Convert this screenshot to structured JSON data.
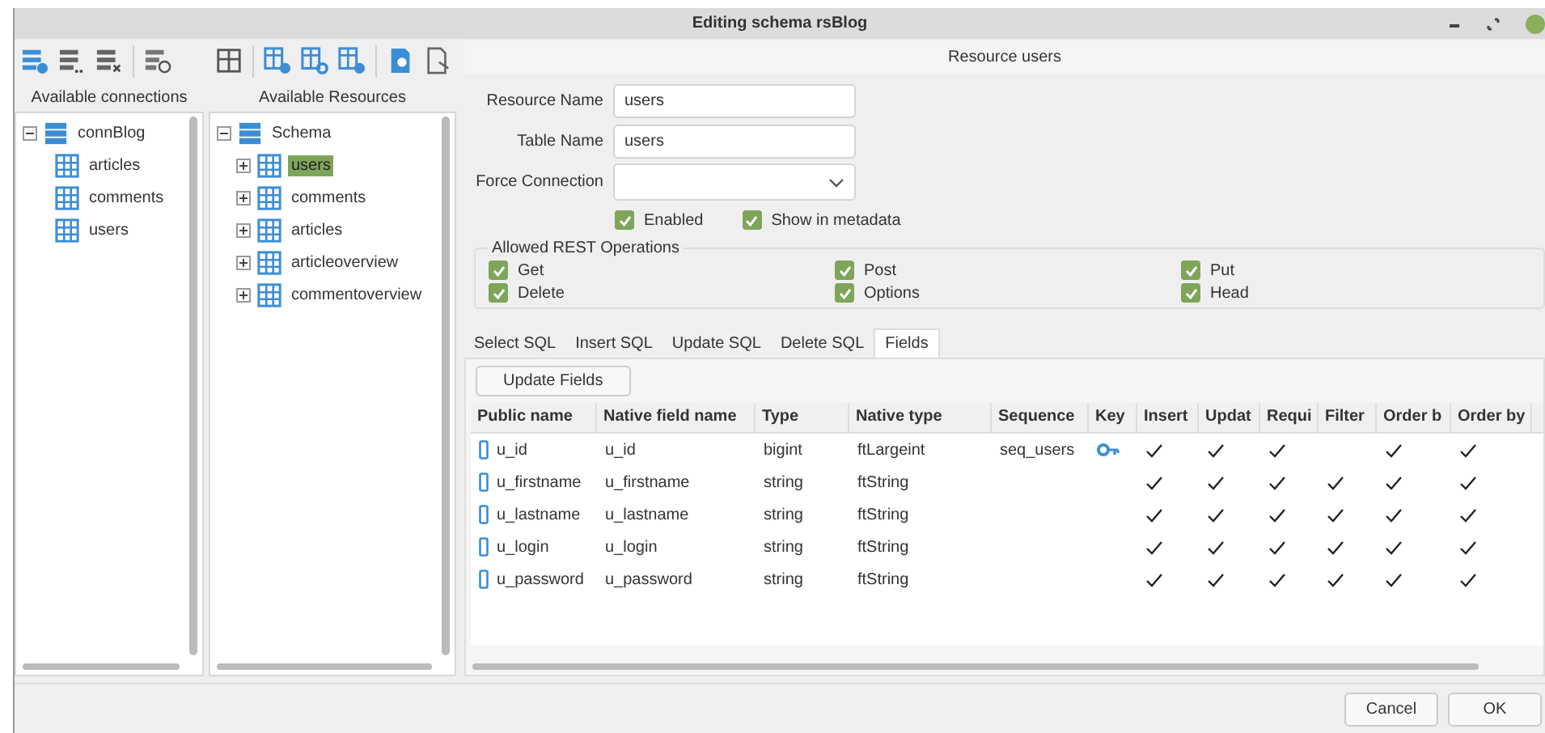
{
  "window": {
    "title": "Editing schema rsBlog"
  },
  "connections": {
    "label": "Available connections",
    "tree": [
      {
        "label": "connBlog",
        "kind": "database",
        "expanded": true,
        "children": [
          {
            "label": "articles",
            "kind": "table"
          },
          {
            "label": "comments",
            "kind": "table"
          },
          {
            "label": "users",
            "kind": "table"
          }
        ]
      }
    ]
  },
  "resources": {
    "label": "Available Resources",
    "tree": [
      {
        "label": "Schema",
        "kind": "database",
        "expanded": true,
        "selected": false,
        "children": [
          {
            "label": "users",
            "kind": "table",
            "expanded": false,
            "selected": true
          },
          {
            "label": "comments",
            "kind": "table",
            "expanded": false,
            "selected": false
          },
          {
            "label": "articles",
            "kind": "table",
            "expanded": false,
            "selected": false
          },
          {
            "label": "articleoverview",
            "kind": "table",
            "expanded": false,
            "selected": false
          },
          {
            "label": "commentoverview",
            "kind": "table",
            "expanded": false,
            "selected": false
          }
        ]
      }
    ]
  },
  "editor": {
    "header": "Resource users",
    "fields": [
      {
        "label": "Resource Name",
        "kind": "text",
        "value": "users"
      },
      {
        "label": "Table Name",
        "kind": "text",
        "value": "users"
      },
      {
        "label": "Force Connection",
        "kind": "select"
      }
    ],
    "options": [
      {
        "label": "Enabled",
        "checked": true
      },
      {
        "label": "Show in metadata",
        "checked": true
      }
    ],
    "rest": {
      "title": "Allowed REST Operations",
      "operations": [
        {
          "label": "Get",
          "checked": true
        },
        {
          "label": "Post",
          "checked": true
        },
        {
          "label": "Put",
          "checked": true
        },
        {
          "label": "Delete",
          "checked": true
        },
        {
          "label": "Options",
          "checked": true
        },
        {
          "label": "Head",
          "checked": true
        }
      ]
    },
    "tabs": [
      {
        "label": "Select SQL",
        "selected": false
      },
      {
        "label": "Insert SQL",
        "selected": false
      },
      {
        "label": "Update SQL",
        "selected": false
      },
      {
        "label": "Delete SQL",
        "selected": false
      },
      {
        "label": "Fields",
        "selected": true
      }
    ],
    "update_button": "Update Fields",
    "table": {
      "columns": [
        "Public name",
        "Native field name",
        "Type",
        "Native type",
        "Sequence",
        "Key",
        "Insert",
        "Updat",
        "Requi",
        "Filter",
        "Order b",
        "Order by"
      ],
      "rows": [
        {
          "public_name": "u_id",
          "native_name": "u_id",
          "type": "bigint",
          "native_type": "ftLargeint",
          "sequence": "seq_users",
          "key": true,
          "flags": [
            true,
            true,
            true,
            false,
            true,
            true
          ]
        },
        {
          "public_name": "u_firstname",
          "native_name": "u_firstname",
          "type": "string",
          "native_type": "ftString",
          "key": false,
          "flags": [
            true,
            true,
            true,
            true,
            true,
            true
          ]
        },
        {
          "public_name": "u_lastname",
          "native_name": "u_lastname",
          "type": "string",
          "native_type": "ftString",
          "key": false,
          "flags": [
            true,
            true,
            true,
            true,
            true,
            true
          ]
        },
        {
          "public_name": "u_login",
          "native_name": "u_login",
          "type": "string",
          "native_type": "ftString",
          "key": false,
          "flags": [
            true,
            true,
            true,
            true,
            true,
            true
          ]
        },
        {
          "public_name": "u_password",
          "native_name": "u_password",
          "type": "string",
          "native_type": "ftString",
          "key": false,
          "flags": [
            true,
            true,
            true,
            true,
            true,
            true
          ]
        }
      ]
    }
  },
  "buttons": [
    "Cancel",
    "OK"
  ]
}
